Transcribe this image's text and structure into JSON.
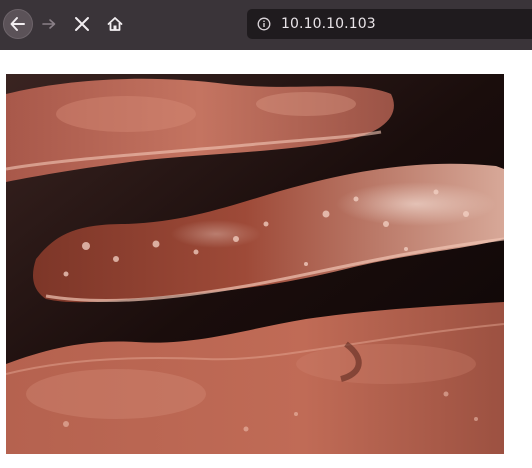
{
  "browser": {
    "url": "10.10.10.103",
    "icons": {
      "back": "arrow-left-icon",
      "forward": "arrow-right-icon",
      "stop": "close-icon",
      "home": "home-icon",
      "site_info": "info-icon"
    }
  },
  "page": {
    "image_subject": "bacon-photo"
  },
  "colors": {
    "toolbar": "#3a3439",
    "urlbar": "#1f1b1e",
    "url_text": "#e9e4e8"
  }
}
